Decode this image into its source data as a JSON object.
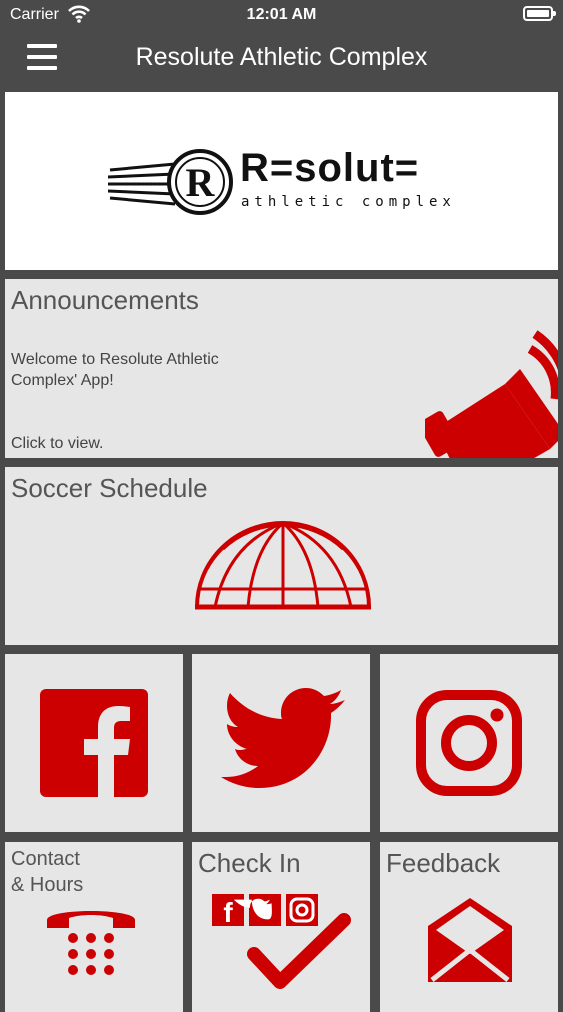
{
  "status_bar": {
    "carrier": "Carrier",
    "time": "12:01 AM"
  },
  "nav": {
    "title": "Resolute Athletic Complex"
  },
  "logo": {
    "word": "R=solut=",
    "subtitle": "athletic complex",
    "badge_letter": "R"
  },
  "announcements": {
    "title": "Announcements",
    "text": "Welcome to Resolute Athletic Complex' App!",
    "click": "Click to view."
  },
  "soccer": {
    "title": "Soccer Schedule"
  },
  "social": {
    "facebook_icon": "facebook-icon",
    "twitter_icon": "twitter-icon",
    "instagram_icon": "instagram-icon"
  },
  "contact": {
    "line1": "Contact",
    "line2": "& Hours"
  },
  "checkin": {
    "title": "Check In"
  },
  "feedback": {
    "title": "Feedback"
  },
  "colors": {
    "accent": "#cc0000",
    "tile": "#e6e6e6",
    "background": "#4a4a4a"
  }
}
